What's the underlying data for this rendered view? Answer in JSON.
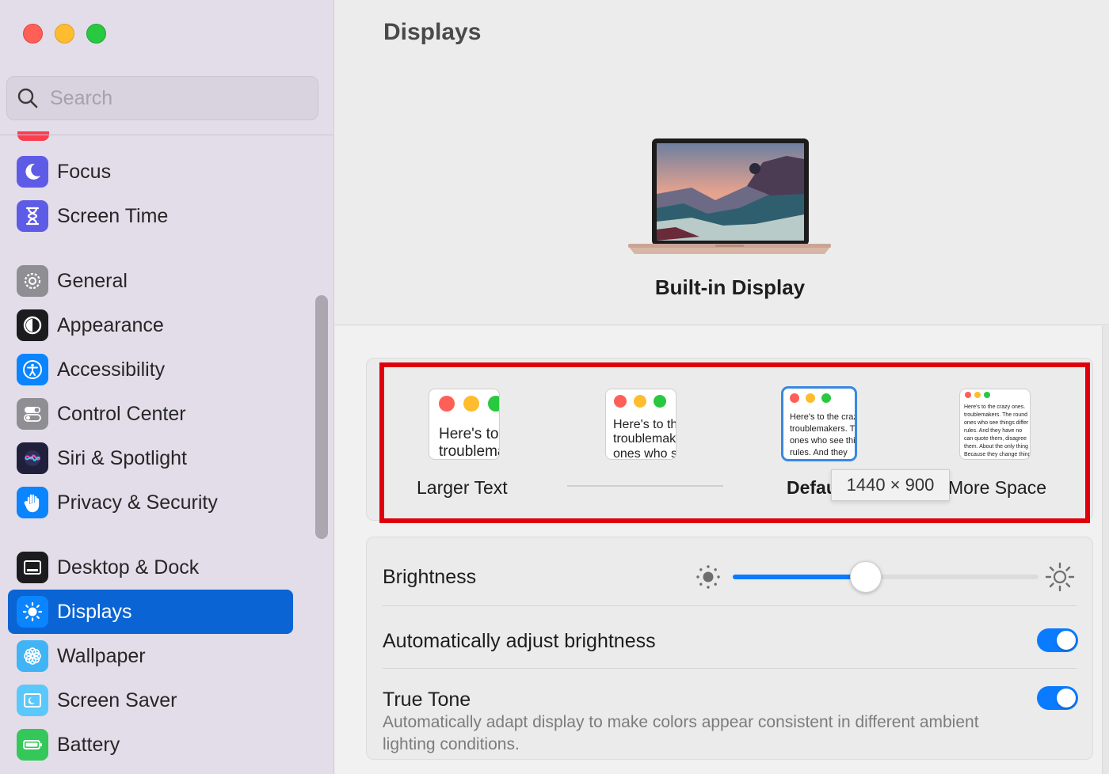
{
  "window": {
    "traffic_lights": [
      "close",
      "minimize",
      "zoom"
    ]
  },
  "sidebar": {
    "search": {
      "placeholder": "Search",
      "value": ""
    },
    "items": [
      {
        "label": "Focus",
        "icon": "moon-icon",
        "color": "#5e5ce6"
      },
      {
        "label": "Screen Time",
        "icon": "hourglass-icon",
        "color": "#5e5ce6"
      },
      {
        "label": "General",
        "icon": "gear-icon",
        "color": "#8e8e93"
      },
      {
        "label": "Appearance",
        "icon": "appearance-icon",
        "color": "#1c1c1e"
      },
      {
        "label": "Accessibility",
        "icon": "accessibility-icon",
        "color": "#0a84ff"
      },
      {
        "label": "Control Center",
        "icon": "toggles-icon",
        "color": "#8e8e93"
      },
      {
        "label": "Siri & Spotlight",
        "icon": "siri-icon",
        "color": "#2c2c54"
      },
      {
        "label": "Privacy & Security",
        "icon": "hand-icon",
        "color": "#0a84ff"
      },
      {
        "label": "Desktop & Dock",
        "icon": "dock-icon",
        "color": "#1c1c1e"
      },
      {
        "label": "Displays",
        "icon": "sun-icon",
        "color": "#0a84ff",
        "selected": true
      },
      {
        "label": "Wallpaper",
        "icon": "flower-icon",
        "color": "#40b4f5"
      },
      {
        "label": "Screen Saver",
        "icon": "screensaver-icon",
        "color": "#5ac8fa"
      },
      {
        "label": "Battery",
        "icon": "battery-icon",
        "color": "#34c759"
      }
    ]
  },
  "main": {
    "title": "Displays",
    "display_name": "Built-in Display",
    "resolution": {
      "options": [
        {
          "label": "Larger Text",
          "preview_text": "Here's to the crazy ones\ntroublemakers"
        },
        {
          "label": "",
          "preview_text": "Here's to the\ntroublemakers.\nones who see"
        },
        {
          "label": "Default",
          "preview_text": "Here's to the crazy\ntroublemakers. The\nones who see things\nrules. And they",
          "selected": true
        },
        {
          "label": "More Space",
          "preview_text": "Here's to the crazy ones.\ntroublemakers. The round\nones who see things differ\nrules. And they have no\ncan quote them, disagree\nthem. About the only thing\nBecause they change things"
        }
      ],
      "tooltip": "1440 × 900"
    },
    "brightness": {
      "label": "Brightness",
      "value_fraction": 0.4
    },
    "auto_brightness": {
      "label": "Automatically adjust brightness",
      "enabled": true
    },
    "true_tone": {
      "label": "True Tone",
      "description": "Automatically adapt display to make colors appear consistent in different ambient lighting conditions.",
      "enabled": true
    },
    "accent_color": "#0a7aff",
    "highlight_color": "#e0000c"
  }
}
